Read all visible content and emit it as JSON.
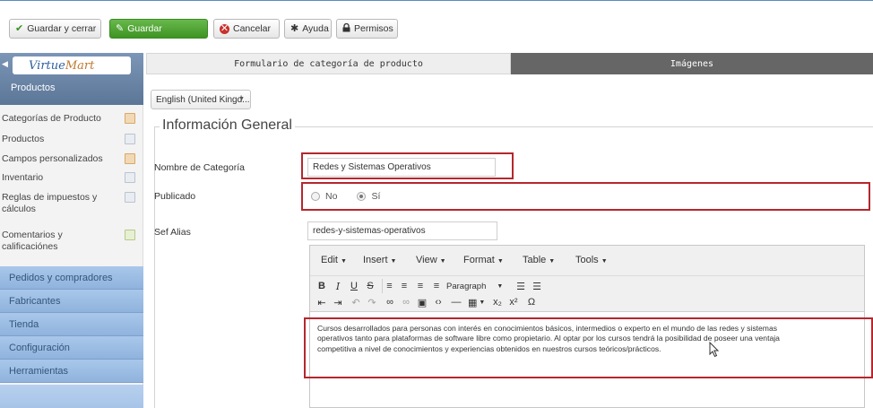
{
  "toolbar": {
    "save_close": "Guardar y cerrar",
    "save": "Guardar",
    "cancel": "Cancelar",
    "help": "Ayuda",
    "permissions": "Permisos"
  },
  "sidebar": {
    "logo_virtue": "Virtue",
    "logo_mart": "Mart",
    "title": "Productos",
    "items": [
      {
        "label": "Categorías de Producto",
        "icon": "folder-icon"
      },
      {
        "label": "Productos",
        "icon": "box-icon"
      },
      {
        "label": "Campos personalizados",
        "icon": "edit-icon"
      },
      {
        "label": "Inventario",
        "icon": "list-icon"
      },
      {
        "label": "Reglas de impuestos y cálculos",
        "icon": "calculator-icon"
      },
      {
        "label": "Comentarios y calificaciónes",
        "icon": "chat-icon"
      }
    ],
    "sections": [
      {
        "label": "Pedidos y compradores"
      },
      {
        "label": "Fabricantes"
      },
      {
        "label": "Tienda"
      },
      {
        "label": "Configuración"
      },
      {
        "label": "Herramientas"
      }
    ]
  },
  "tabs": [
    {
      "label": "Formulario de categoría de producto",
      "active": true
    },
    {
      "label": "Imágenes",
      "active": false
    }
  ],
  "language_select": {
    "value": "English (United Kingd..."
  },
  "fieldset": {
    "legend": "Información General"
  },
  "form": {
    "category_name_label": "Nombre de Categoría",
    "category_name_value": "Redes y Sistemas Operativos",
    "published_label": "Publicado",
    "published_no": "No",
    "published_yes": "Sí",
    "published_selected": "Sí",
    "sef_alias_label": "Sef Alias",
    "sef_alias_value": "redes-y-sistemas-operativos"
  },
  "editor": {
    "menus": [
      "Edit",
      "Insert",
      "View",
      "Format",
      "Table",
      "Tools"
    ],
    "format_select": "Paragraph",
    "body_lines": [
      "Cursos desarrollados para personas con interés en conocimientos básicos, intermedios o experto en el mundo de las redes y sistemas",
      "operativos tanto para plataformas de software libre como propietario. Al optar por los cursos tendrá la posibilidad de poseer una ventaja",
      "competitiva a nivel de conocimientos y experiencias  obtenidos en nuestros cursos teóricos/prácticos."
    ]
  },
  "colors": {
    "save_green": "#3e9323",
    "highlight_red": "#b5272d",
    "sidebar_header": "#5b7697",
    "sidebar_section": "#a9c7ea",
    "inactive_tab": "#666666"
  }
}
